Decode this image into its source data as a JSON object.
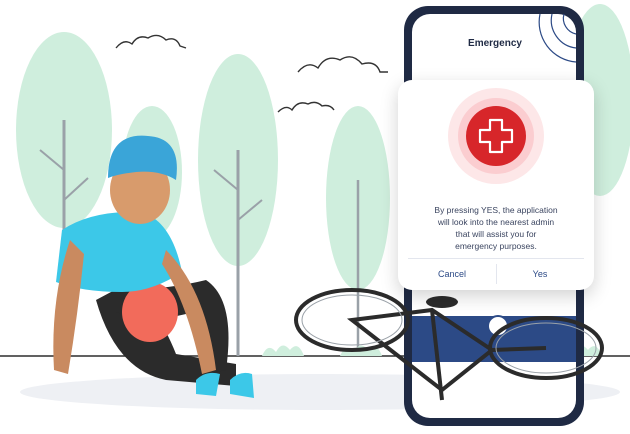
{
  "phone": {
    "title": "Emergency"
  },
  "dialog": {
    "message_lines": [
      "By pressing YES, the application",
      "will look into the nearest admin",
      "that will assist you for",
      "emergency purposes."
    ],
    "cancel_label": "Cancel",
    "yes_label": "Yes"
  },
  "colors": {
    "emergency_red": "#d7262a",
    "tree_green": "#cfeedd",
    "helmet_blue": "#3aa5d8",
    "shirt_cyan": "#3cc8e8",
    "phone_frame": "#1f2a44",
    "accent_blue": "#2c4a86"
  },
  "icons": [
    "plus-icon",
    "cloud-icon",
    "tree-icon",
    "bicycle-icon"
  ]
}
